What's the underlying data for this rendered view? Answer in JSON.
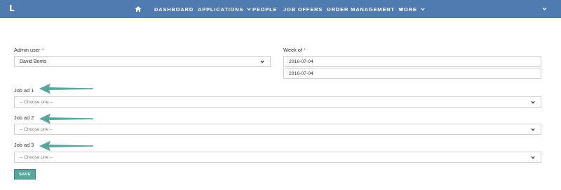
{
  "app": {
    "logo": "L"
  },
  "nav": {
    "home_icon": "home-icon",
    "items": [
      {
        "label": "Dashboard"
      },
      {
        "label": "Applications"
      },
      {
        "label": "People"
      },
      {
        "label": "Job Offers"
      },
      {
        "label": "Order Management"
      },
      {
        "label": "More"
      }
    ]
  },
  "form": {
    "admin_user": {
      "label": "Admin user",
      "required_mark": "*",
      "value": "David Bento"
    },
    "week_of": {
      "label": "Week of",
      "required_mark": "*",
      "value": "2016-07-04",
      "value2": "2016-07-04"
    },
    "job_ad_1": {
      "label": "Job ad 1",
      "placeholder": "-- Choose one --"
    },
    "job_ad_2": {
      "label": "Job ad 2",
      "placeholder": "-- Choose one --"
    },
    "job_ad_3": {
      "label": "Job ad 3",
      "placeholder": "-- Choose one --"
    },
    "save_label": "SAVE"
  },
  "colors": {
    "topbar": "#4f7bb0",
    "save_button": "#5aa59c",
    "annotation_arrow": "#5aa59c",
    "required": "#d9534f"
  }
}
